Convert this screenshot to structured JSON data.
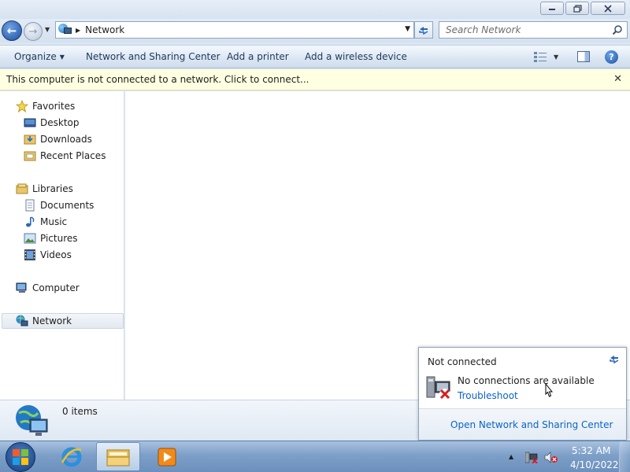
{
  "window": {
    "caption_buttons": [
      "minimize-icon",
      "restore-icon",
      "close-icon"
    ]
  },
  "address": {
    "location": "Network",
    "search_placeholder": "Search Network"
  },
  "commandbar": {
    "organize": "Organize",
    "network_sharing": "Network and Sharing Center",
    "add_printer": "Add a printer",
    "add_wireless": "Add a wireless device"
  },
  "infobar": {
    "text": "This computer is not connected to a network. Click to connect...",
    "close_glyph": "✕"
  },
  "navpane": {
    "favorites": "Favorites",
    "desktop": "Desktop",
    "downloads": "Downloads",
    "recent_places": "Recent Places",
    "libraries": "Libraries",
    "documents": "Documents",
    "music": "Music",
    "pictures": "Pictures",
    "videos": "Videos",
    "computer": "Computer",
    "network": "Network"
  },
  "details": {
    "item_count": "0 items"
  },
  "flyout": {
    "title": "Not connected",
    "message": "No connections are available",
    "troubleshoot": "Troubleshoot",
    "footer_link": "Open Network and Sharing Center"
  },
  "taskbar": {
    "clock_time": "5:32 AM",
    "clock_date": "4/10/2022"
  },
  "colors": {
    "link": "#0b63c7",
    "infobar_bg": "#ffffe1",
    "taskbar": "#7d9fc8"
  }
}
